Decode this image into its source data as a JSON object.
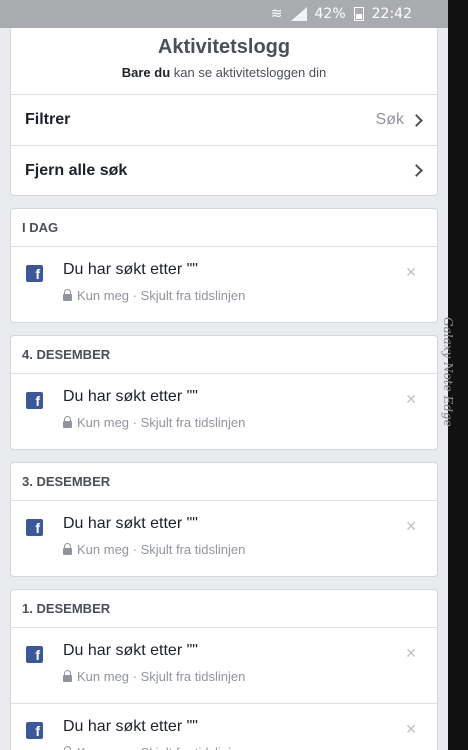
{
  "statusbar": {
    "battery": "42%",
    "time": "22:42"
  },
  "header": {
    "title": "Aktivitetslogg",
    "sub_bold": "Bare du",
    "sub_rest": " kan se aktivitetsloggen din"
  },
  "filters": {
    "filter_label": "Filtrer",
    "filter_value": "Søk",
    "clear_label": "Fjern alle søk"
  },
  "sections": [
    {
      "heading": "I DAG",
      "entries": [
        {
          "text": "Du har søkt etter \"\"",
          "meta": "Kun meg · Skjult fra tidslinjen"
        }
      ]
    },
    {
      "heading": "4. DESEMBER",
      "entries": [
        {
          "text": "Du har søkt etter \"\"",
          "meta": "Kun meg · Skjult fra tidslinjen"
        }
      ]
    },
    {
      "heading": "3. DESEMBER",
      "entries": [
        {
          "text": "Du har søkt etter \"\"",
          "meta": "Kun meg · Skjult fra tidslinjen"
        }
      ]
    },
    {
      "heading": "1. DESEMBER",
      "entries": [
        {
          "text": "Du har søkt etter \"\"",
          "meta": "Kun meg · Skjult fra tidslinjen"
        },
        {
          "text": "Du har søkt etter \"\"",
          "meta": "Kun meg · Skjult fra tidslinjen"
        }
      ]
    }
  ],
  "icons": {
    "app": "facebook-icon",
    "privacy": "lock-icon",
    "remove": "close-icon"
  },
  "colors": {
    "brand": "#3b5998",
    "background": "#e9ebee"
  },
  "device_edge_label": "Galaxy Note Edge"
}
